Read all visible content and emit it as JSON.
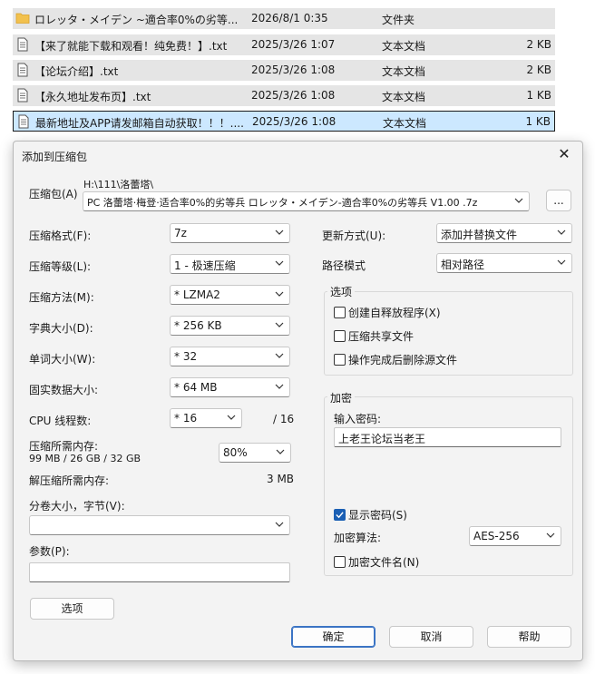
{
  "files": [
    {
      "name": "ロレッタ・メイデン ~適合率0%の劣等...",
      "date": "2026/8/1 0:35",
      "type": "文件夹",
      "size": "",
      "icon": "folder-icon",
      "selected": false
    },
    {
      "name": "【来了就能下载和观看！纯免费！】.txt",
      "date": "2025/3/26 1:07",
      "type": "文本文档",
      "size": "2 KB",
      "icon": "text-file-icon",
      "selected": false
    },
    {
      "name": "【论坛介绍】.txt",
      "date": "2025/3/26 1:08",
      "type": "文本文档",
      "size": "2 KB",
      "icon": "text-file-icon",
      "selected": false
    },
    {
      "name": "【永久地址发布页】.txt",
      "date": "2025/3/26 1:08",
      "type": "文本文档",
      "size": "1 KB",
      "icon": "text-file-icon",
      "selected": false
    },
    {
      "name": "最新地址及APP请发邮箱自动获取！！！....",
      "date": "2025/3/26 1:08",
      "type": "文本文档",
      "size": "1 KB",
      "icon": "text-file-icon",
      "selected": true
    }
  ],
  "dialog": {
    "title": "添加到压缩包",
    "close": "✕",
    "archive_label": "压缩包(A)",
    "archive_path": "H:\\111\\洛蕾塔\\",
    "archive_name": "PC 洛蕾塔·梅登·适合率0%的劣等兵 ロレッタ・メイデン-適合率0%の劣等兵 V1.00 .7z",
    "browse_label": "...",
    "format_label": "压缩格式(F):",
    "format_value": "7z",
    "level_label": "压缩等级(L):",
    "level_value": "1 - 极速压缩",
    "method_label": "压缩方法(M):",
    "method_value": "* LZMA2",
    "dict_label": "字典大小(D):",
    "dict_value": "* 256 KB",
    "word_label": "单词大小(W):",
    "word_value": "* 32",
    "solid_label": "固实数据大小:",
    "solid_value": "* 64 MB",
    "cpu_label": "CPU 线程数:",
    "cpu_value": "* 16",
    "cpu_max": "/ 16",
    "mem_comp_label": "压缩所需内存:",
    "mem_comp_value": "99 MB / 26 GB / 32 GB",
    "mem_percent": "80%",
    "mem_decomp_label": "解压缩所需内存:",
    "mem_decomp_value": "3 MB",
    "split_label": "分卷大小，字节(V):",
    "split_value": "",
    "params_label": "参数(P):",
    "params_value": "",
    "options_button": "选项",
    "update_label": "更新方式(U):",
    "update_value": "添加并替换文件",
    "path_label": "路径模式",
    "path_value": "相对路径",
    "options_group": "选项",
    "opt_sfx": "创建自释放程序(X)",
    "opt_shared": "压缩共享文件",
    "opt_delete": "操作完成后删除源文件",
    "encrypt_group": "加密",
    "password_label": "输入密码:",
    "password_value": "上老王论坛当老王",
    "show_password": "显示密码(S)",
    "enc_method_label": "加密算法:",
    "enc_method_value": "AES-256",
    "enc_names": "加密文件名(N)",
    "ok_button": "确定",
    "cancel_button": "取消",
    "help_button": "帮助"
  }
}
